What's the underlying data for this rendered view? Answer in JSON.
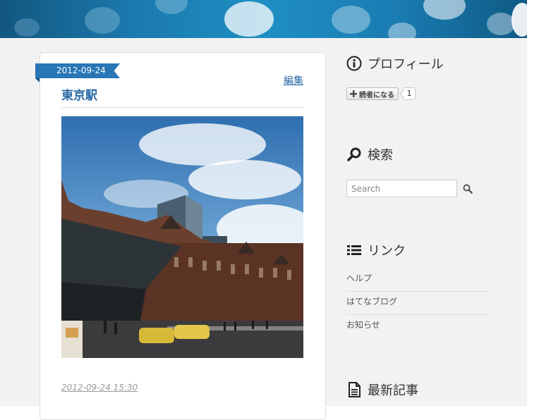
{
  "entry": {
    "date": "2012-09-24",
    "title": "東京駅",
    "edit_label": "編集",
    "timestamp": "2012-09-24 15:30"
  },
  "sidebar": {
    "profile": {
      "title": "プロフィール",
      "subscribe_label": "読者になる",
      "subscriber_count": "1"
    },
    "search": {
      "title": "検索",
      "placeholder": "Search"
    },
    "links": {
      "title": "リンク",
      "items": [
        "ヘルプ",
        "はてなブログ",
        "お知らせ"
      ]
    },
    "recent": {
      "title": "最新記事"
    }
  },
  "colors": {
    "accent": "#2876b6",
    "title": "#2a6aa5",
    "background": "#f2f2f2"
  }
}
